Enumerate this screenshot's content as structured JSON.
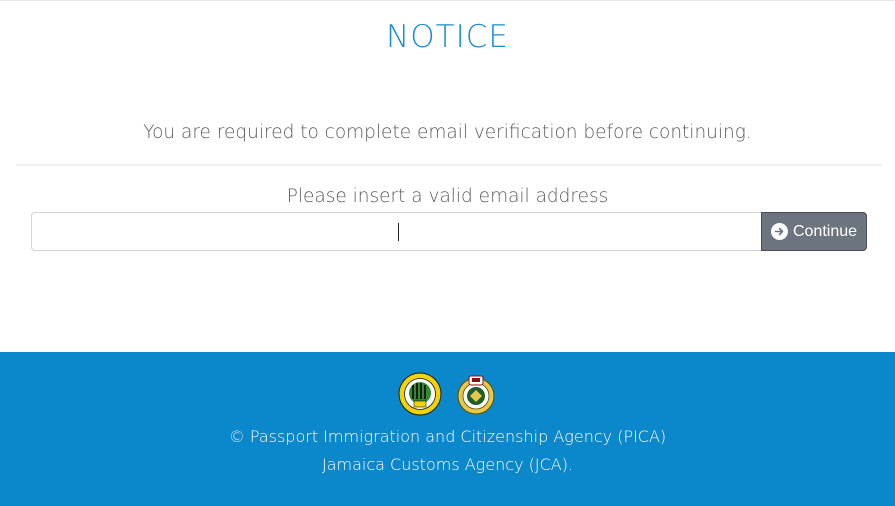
{
  "notice": {
    "title": "NOTICE",
    "message": "You are required to complete email verification before continuing."
  },
  "email": {
    "label": "Please insert a valid email address",
    "value": "",
    "placeholder": ""
  },
  "continue_button": {
    "label": "Continue",
    "icon": "arrow-circle-right-icon"
  },
  "footer": {
    "copyright_line": "© Passport Immigration and Citizenship Agency (PICA)",
    "agency_line": "Jamaica Customs Agency (JCA).",
    "logos": [
      "pica-logo",
      "jca-logo"
    ],
    "background_color": "#0b87cc"
  },
  "colors": {
    "title": "#1b8dd0",
    "button": "#6c757d"
  }
}
